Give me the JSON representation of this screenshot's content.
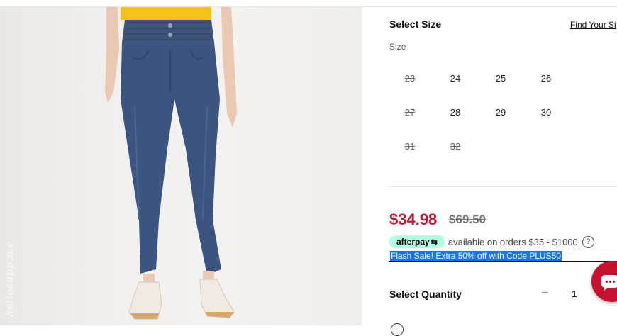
{
  "watermark": "hellosupp.me",
  "product_image": {
    "alt": "high-waisted tapered jeans"
  },
  "size_selector": {
    "title": "Select Size",
    "find_link": "Find Your Si",
    "label": "Size",
    "sizes": [
      {
        "label": "23",
        "available": false
      },
      {
        "label": "24",
        "available": true
      },
      {
        "label": "25",
        "available": true
      },
      {
        "label": "26",
        "available": true
      },
      {
        "label": "27",
        "available": false
      },
      {
        "label": "28",
        "available": true
      },
      {
        "label": "29",
        "available": true
      },
      {
        "label": "30",
        "available": true
      },
      {
        "label": "31",
        "available": false
      },
      {
        "label": "32",
        "available": false
      }
    ]
  },
  "pricing": {
    "sale_price": "$34.98",
    "original_price": "$69.50",
    "sale_color": "#c41230"
  },
  "afterpay": {
    "badge": "afterpay",
    "text": "available on orders $35 - $1000",
    "help": "?"
  },
  "promo": {
    "text": "Flash Sale! Extra 50% off with Code PLUS50"
  },
  "quantity": {
    "title": "Select Quantity",
    "minus": "–",
    "value": "1",
    "plus": "+"
  },
  "chat": {
    "icon": "chat-icon",
    "color": "#c41230"
  }
}
